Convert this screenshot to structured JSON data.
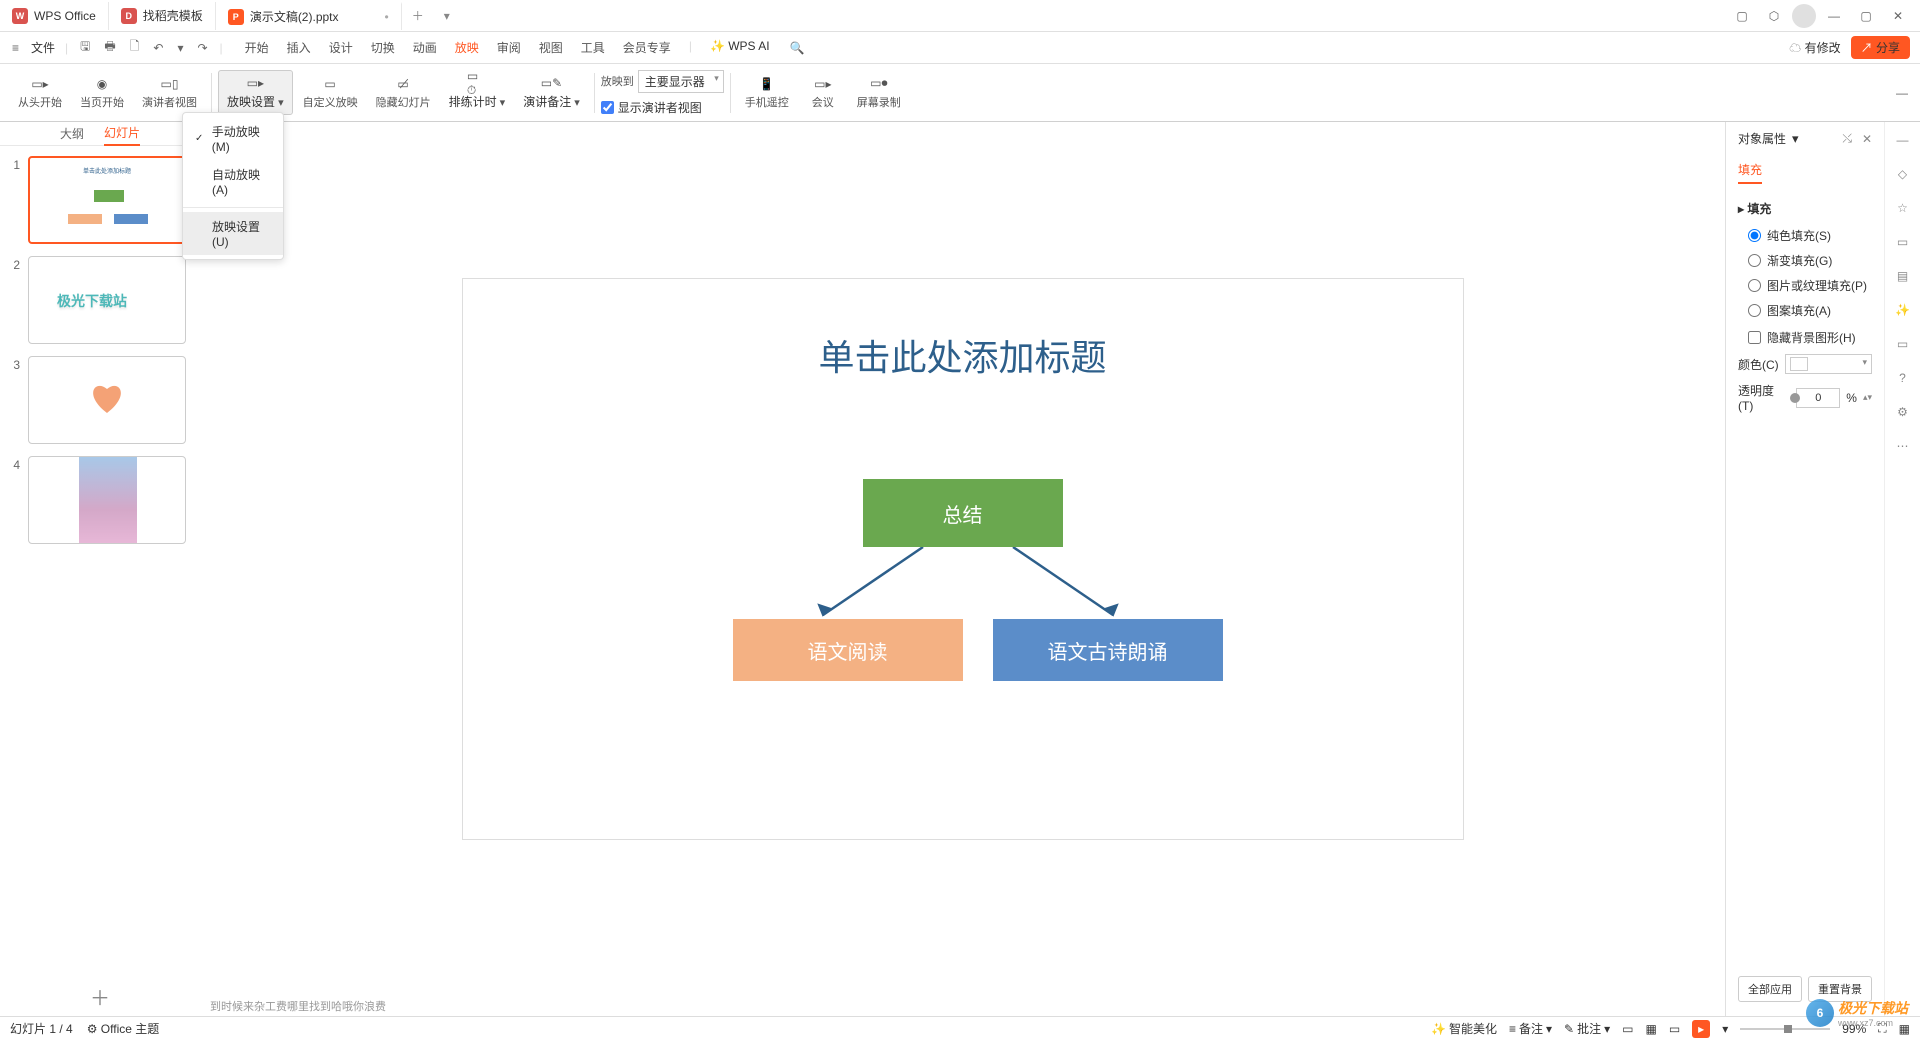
{
  "tabs": {
    "home": "WPS Office",
    "template": "找稻壳模板",
    "doc": "演示文稿(2).pptx"
  },
  "menu": {
    "file": "文件",
    "start": "开始",
    "insert": "插入",
    "design": "设计",
    "transition": "切换",
    "animation": "动画",
    "slideshow": "放映",
    "review": "审阅",
    "view": "视图",
    "tools": "工具",
    "member": "会员专享",
    "ai": "WPS AI",
    "modified": "有修改",
    "share": "分享"
  },
  "ribbon": {
    "from_start": "从头开始",
    "from_current": "当页开始",
    "presenter": "演讲者视图",
    "settings": "放映设置",
    "custom": "自定义放映",
    "hide": "隐藏幻灯片",
    "rehearse": "排练计时",
    "notes": "演讲备注",
    "cast_to": "放映到",
    "monitor": "主要显示器",
    "show_presenter": "显示演讲者视图",
    "remote": "手机遥控",
    "meeting": "会议",
    "record": "屏幕录制"
  },
  "dropdown": {
    "manual": "手动放映(M)",
    "auto": "自动放映(A)",
    "settings": "放映设置(U)"
  },
  "view_tabs": {
    "outline": "大纲",
    "slides": "幻灯片"
  },
  "slide": {
    "title": "单击此处添加标题",
    "box1": "总结",
    "box2": "语文阅读",
    "box3": "语文古诗朗诵",
    "thumb2": "极光下载站"
  },
  "notes": "到时候来杂工费哪里找到哈哦你浪费",
  "props": {
    "header": "对象属性",
    "tab": "填充",
    "section": "填充",
    "solid": "纯色填充(S)",
    "gradient": "渐变填充(G)",
    "picture": "图片或纹理填充(P)",
    "pattern": "图案填充(A)",
    "hide_bg": "隐藏背景图形(H)",
    "color": "颜色(C)",
    "opacity": "透明度(T)",
    "opacity_val": "0",
    "opacity_unit": "%",
    "apply_all": "全部应用",
    "reset": "重置背景"
  },
  "status": {
    "slide": "幻灯片 1 / 4",
    "theme": "Office 主题",
    "beautify": "智能美化",
    "notes": "备注",
    "comments": "批注",
    "zoom": "99%"
  },
  "watermark": "极光下载站"
}
